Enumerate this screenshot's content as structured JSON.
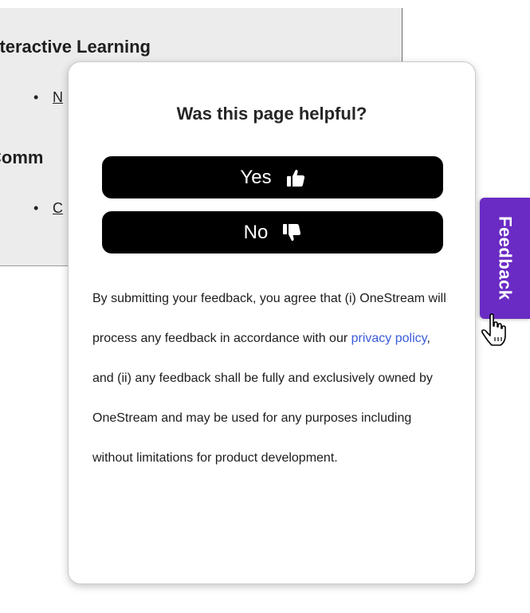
{
  "background": {
    "section1_heading": "nteractive Learning",
    "section1_link": "N",
    "section2_heading": "Comm",
    "section2_link": "C",
    "bullet": "•"
  },
  "popup": {
    "title": "Was this page helpful?",
    "yes_label": "Yes",
    "no_label": "No",
    "yes_icon": "thumbs-up-icon",
    "no_icon": "thumbs-down-icon",
    "disclaimer_before": "By submitting your feedback, you agree that (i) OneStream will process any feedback in accordance with our ",
    "privacy_link": "privacy policy",
    "disclaimer_after": ", and (ii) any feedback shall be fully and exclusively owned by OneStream and may be used for any purposes including without limitations for product development."
  },
  "feedback_tab": {
    "label": "Feedback"
  },
  "colors": {
    "accent": "#6a2bc4",
    "button_bg": "#000000",
    "link": "#3a5bd9",
    "panel_bg": "#ececed"
  }
}
